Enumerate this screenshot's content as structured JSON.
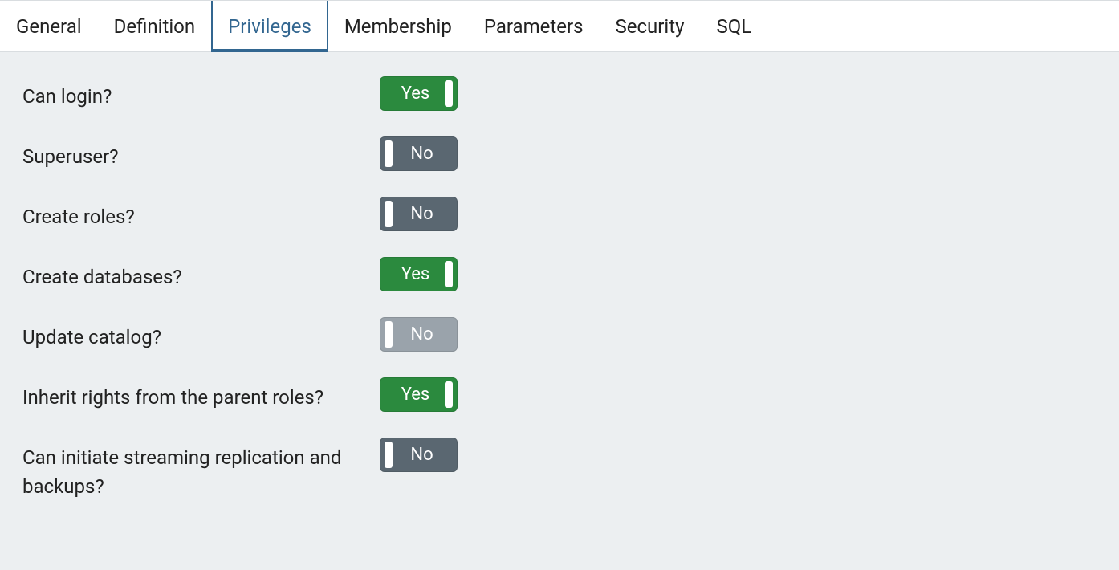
{
  "tabs": {
    "general": "General",
    "definition": "Definition",
    "privileges": "Privileges",
    "membership": "Membership",
    "parameters": "Parameters",
    "security": "Security",
    "sql": "SQL",
    "active": "privileges"
  },
  "toggleLabels": {
    "yes": "Yes",
    "no": "No"
  },
  "privileges": [
    {
      "id": "can-login",
      "label": "Can login?",
      "value": true,
      "disabled": false
    },
    {
      "id": "superuser",
      "label": "Superuser?",
      "value": false,
      "disabled": false
    },
    {
      "id": "create-roles",
      "label": "Create roles?",
      "value": false,
      "disabled": false
    },
    {
      "id": "create-databases",
      "label": "Create databases?",
      "value": true,
      "disabled": false
    },
    {
      "id": "update-catalog",
      "label": "Update catalog?",
      "value": false,
      "disabled": true
    },
    {
      "id": "inherit-rights",
      "label": "Inherit rights from the parent roles?",
      "value": true,
      "disabled": false
    },
    {
      "id": "streaming-replication",
      "label": "Can initiate streaming replication and backups?",
      "value": false,
      "disabled": false
    }
  ]
}
